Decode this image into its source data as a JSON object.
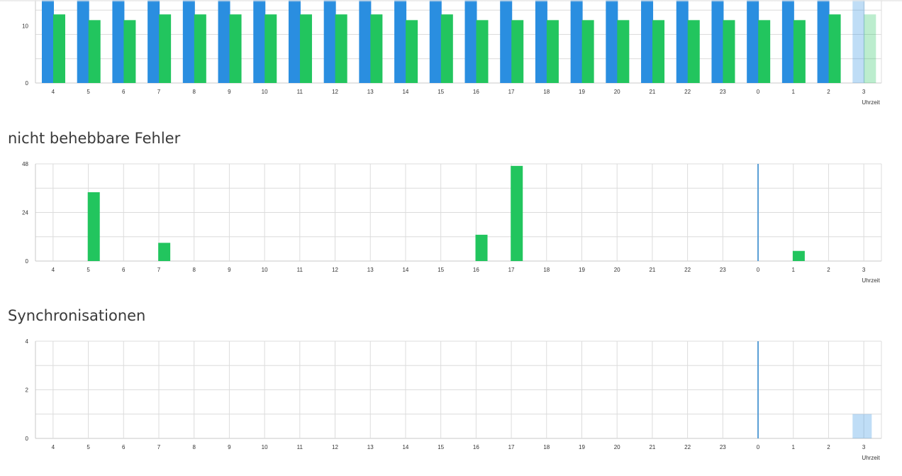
{
  "colors": {
    "blue": "#2a8ee0",
    "green": "#22c55e",
    "grid": "#dcdcdc",
    "axis": "#c8c8c8",
    "marker": "#5a9fd6"
  },
  "sections": [
    {
      "title": "",
      "chart_data": {
        "type": "bar",
        "categories": [
          "4",
          "5",
          "6",
          "7",
          "8",
          "9",
          "10",
          "11",
          "12",
          "13",
          "14",
          "15",
          "16",
          "17",
          "18",
          "19",
          "20",
          "21",
          "22",
          "23",
          "0",
          "1",
          "2",
          "3"
        ],
        "series": [
          {
            "color": "blue",
            "values": [
              null,
              null,
              null,
              null,
              null,
              null,
              null,
              null,
              null,
              null,
              null,
              null,
              null,
              null,
              null,
              null,
              null,
              null,
              null,
              null,
              null,
              null,
              null,
              null
            ]
          },
          {
            "color": "green",
            "values": [
              12,
              11,
              11,
              12,
              12,
              12,
              12,
              12,
              12,
              12,
              11,
              12,
              11,
              11,
              11,
              11,
              11,
              11,
              11,
              11,
              11,
              11,
              12,
              12
            ]
          }
        ],
        "xlabel": "Uhrzeit",
        "yticks": [
          "0",
          "10"
        ],
        "ylim": [
          0,
          17
        ],
        "highlight_last": true,
        "grid": true
      }
    },
    {
      "title": "nicht behebbare Fehler",
      "chart_data": {
        "type": "bar",
        "categories": [
          "4",
          "5",
          "6",
          "7",
          "8",
          "9",
          "10",
          "11",
          "12",
          "13",
          "14",
          "15",
          "16",
          "17",
          "18",
          "19",
          "20",
          "21",
          "22",
          "23",
          "0",
          "1",
          "2",
          "3"
        ],
        "series": [
          {
            "color": "green",
            "values": [
              0,
              34,
              0,
              9,
              0,
              0,
              0,
              0,
              0,
              0,
              0,
              0,
              13,
              47,
              0,
              0,
              0,
              0,
              0,
              0,
              0,
              5,
              0,
              0
            ]
          }
        ],
        "xlabel": "Uhrzeit",
        "yticks": [
          "0",
          "24",
          "48"
        ],
        "ylim": [
          0,
          48
        ],
        "day_marker": "0",
        "grid": true
      }
    },
    {
      "title": "Synchronisationen",
      "chart_data": {
        "type": "bar",
        "categories": [
          "4",
          "5",
          "6",
          "7",
          "8",
          "9",
          "10",
          "11",
          "12",
          "13",
          "14",
          "15",
          "16",
          "17",
          "18",
          "19",
          "20",
          "21",
          "22",
          "23",
          "0",
          "1",
          "2",
          "3"
        ],
        "series": [
          {
            "color": "blue",
            "values": [
              0,
              0,
              0,
              0,
              0,
              0,
              0,
              0,
              0,
              0,
              0,
              0,
              0,
              0,
              0,
              0,
              0,
              0,
              0,
              0,
              0,
              0,
              0,
              1
            ]
          }
        ],
        "xlabel": "Uhrzeit",
        "yticks": [
          "0",
          "2",
          "4"
        ],
        "ylim": [
          0,
          4
        ],
        "day_marker": "0",
        "highlight_last": true,
        "grid": true
      }
    }
  ]
}
